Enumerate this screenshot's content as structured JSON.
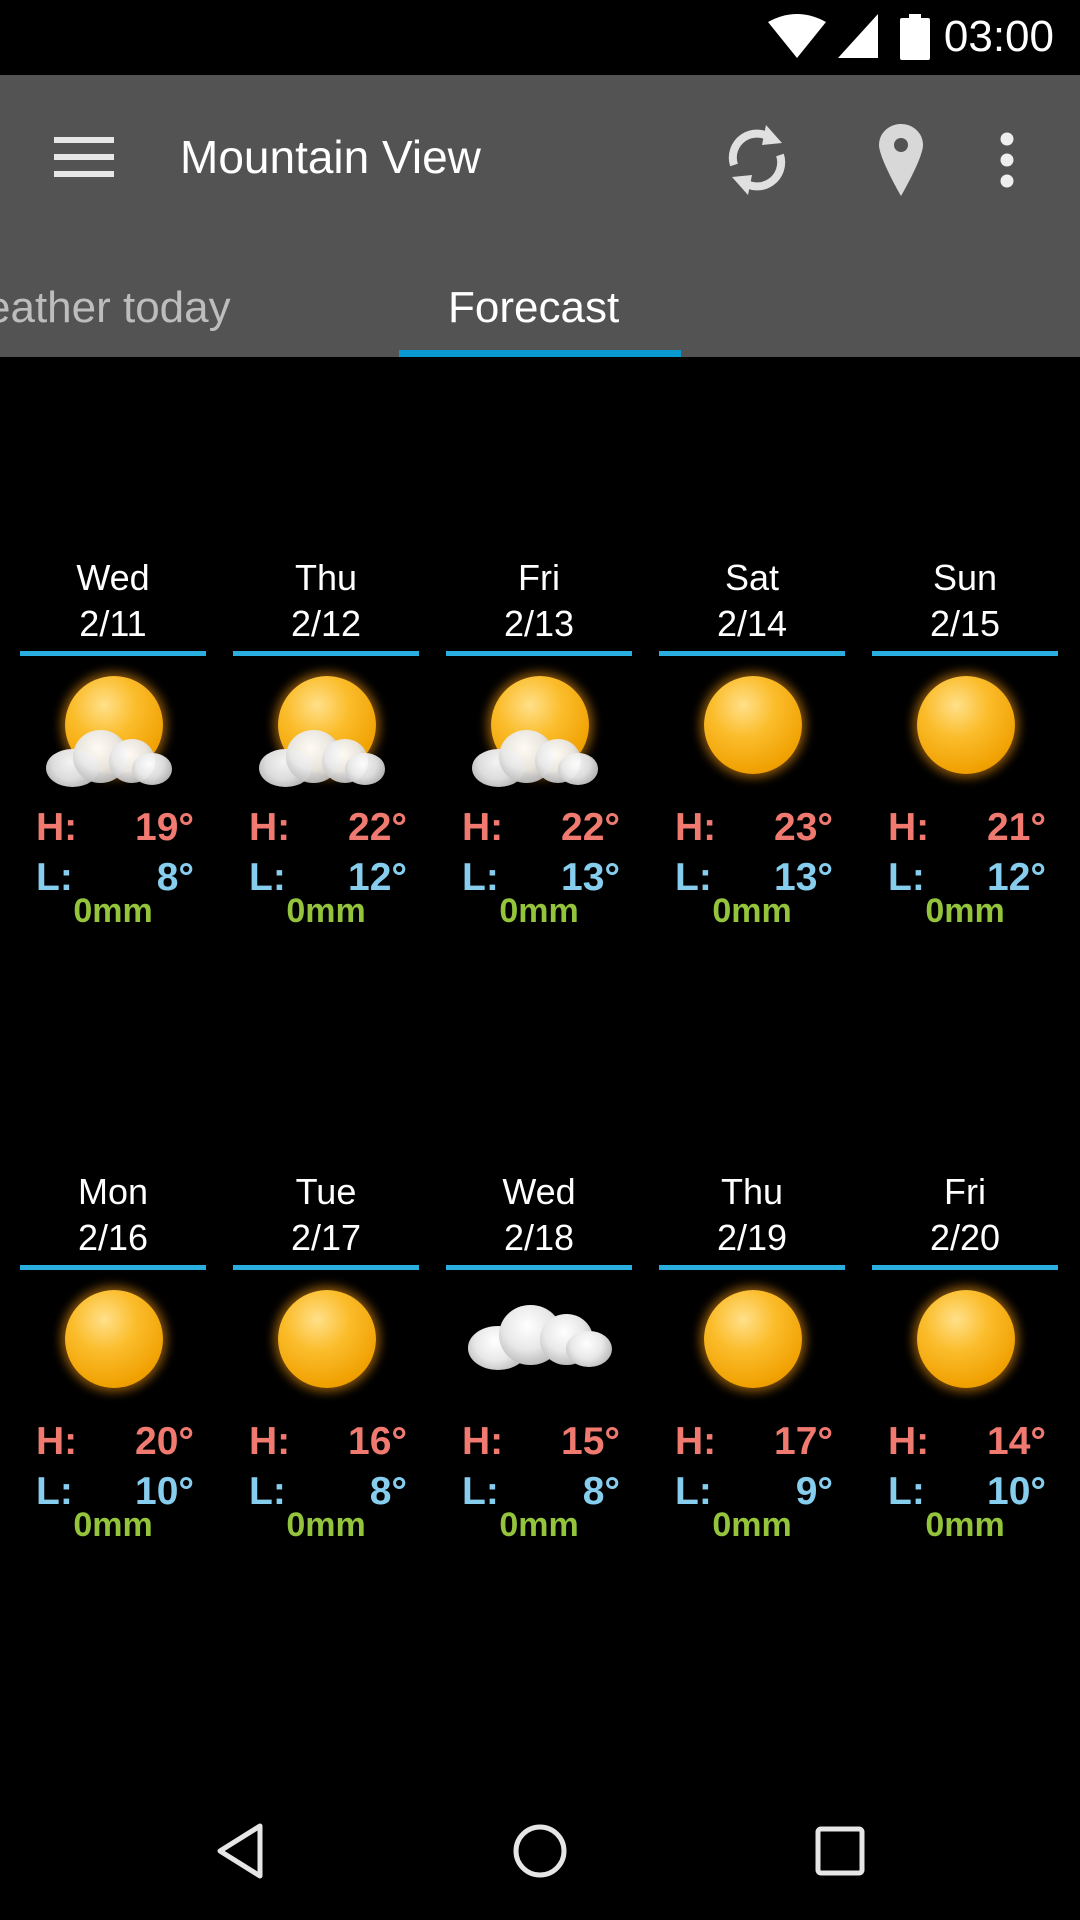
{
  "status_bar": {
    "time": "03:00",
    "icons": [
      "wifi-icon",
      "cell-signal-icon",
      "battery-icon"
    ]
  },
  "app_bar": {
    "title": "Mountain View",
    "menu_icon": "hamburger-menu-icon",
    "actions": [
      {
        "name": "refresh",
        "icon": "refresh-icon"
      },
      {
        "name": "location",
        "icon": "location-pin-icon"
      },
      {
        "name": "overflow",
        "icon": "more-vert-icon"
      }
    ]
  },
  "tabs": [
    {
      "label": "eather today",
      "full_label": "Weather today",
      "selected": false
    },
    {
      "label": "Forecast",
      "selected": true
    }
  ],
  "colors": {
    "accent": "#0a98d0",
    "card_underline": "#2aaee0",
    "high_temp": "#f07a70",
    "low_temp": "#86cdee",
    "rain": "#93c43c",
    "app_bar": "#535353"
  },
  "labels": {
    "high": "H:",
    "low": "L:"
  },
  "forecast": [
    {
      "day": "Wed",
      "date": "2/11",
      "condition": "partly-cloudy",
      "high": "19°",
      "low": "8°",
      "rain": "0mm"
    },
    {
      "day": "Thu",
      "date": "2/12",
      "condition": "partly-cloudy",
      "high": "22°",
      "low": "12°",
      "rain": "0mm"
    },
    {
      "day": "Fri",
      "date": "2/13",
      "condition": "partly-cloudy",
      "high": "22°",
      "low": "13°",
      "rain": "0mm"
    },
    {
      "day": "Sat",
      "date": "2/14",
      "condition": "sunny",
      "high": "23°",
      "low": "13°",
      "rain": "0mm"
    },
    {
      "day": "Sun",
      "date": "2/15",
      "condition": "sunny",
      "high": "21°",
      "low": "12°",
      "rain": "0mm"
    },
    {
      "day": "Mon",
      "date": "2/16",
      "condition": "sunny",
      "high": "20°",
      "low": "10°",
      "rain": "0mm"
    },
    {
      "day": "Tue",
      "date": "2/17",
      "condition": "sunny",
      "high": "16°",
      "low": "8°",
      "rain": "0mm"
    },
    {
      "day": "Wed",
      "date": "2/18",
      "condition": "cloudy",
      "high": "15°",
      "low": "8°",
      "rain": "0mm"
    },
    {
      "day": "Thu",
      "date": "2/19",
      "condition": "sunny",
      "high": "17°",
      "low": "9°",
      "rain": "0mm"
    },
    {
      "day": "Fri",
      "date": "2/20",
      "condition": "sunny",
      "high": "14°",
      "low": "10°",
      "rain": "0mm"
    }
  ],
  "nav_bar": {
    "buttons": [
      "back-icon",
      "home-icon",
      "recents-icon"
    ]
  }
}
